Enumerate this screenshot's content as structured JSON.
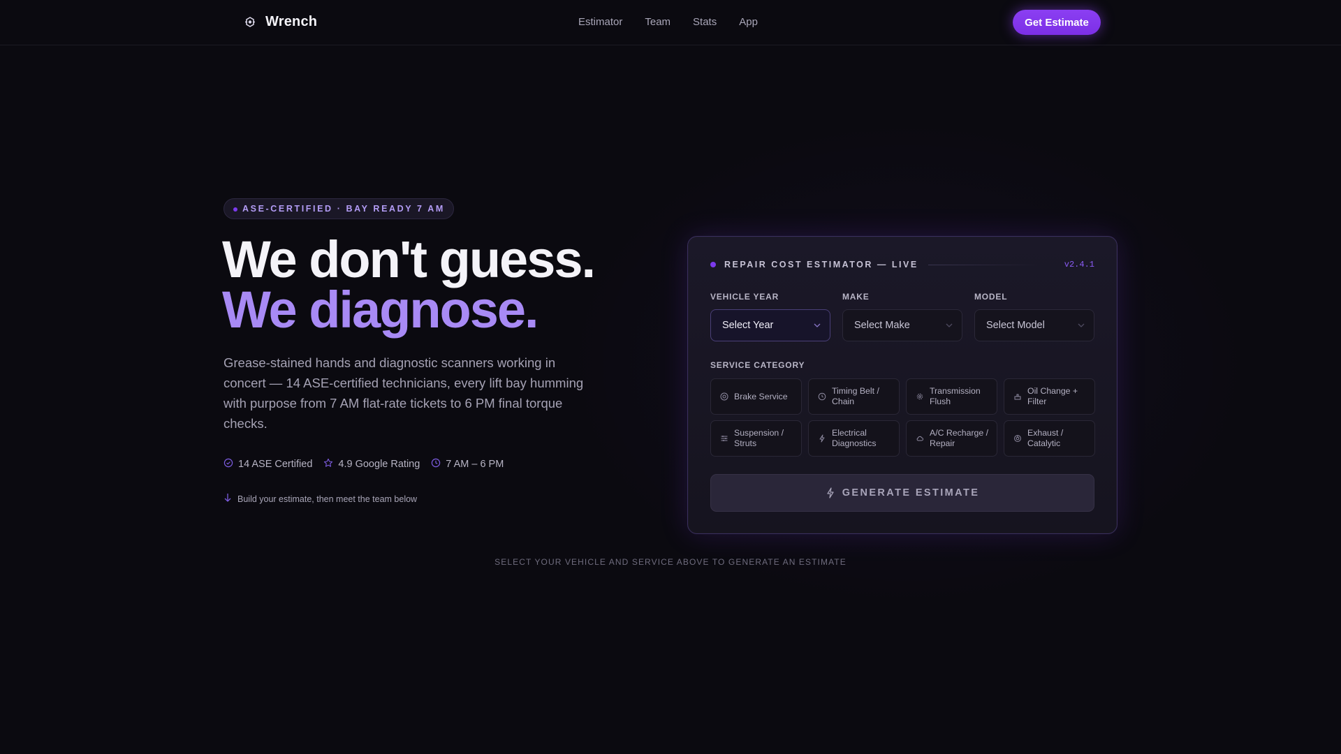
{
  "nav": {
    "brand": "Wrench",
    "links": [
      "Estimator",
      "Team",
      "Stats",
      "App"
    ],
    "cta": "Get Estimate"
  },
  "hero": {
    "badge": "ASE-CERTIFIED · BAY READY 7 AM",
    "headline_1": "We don't guess.",
    "headline_2": "We diagnose.",
    "lead": "Grease-stained hands and diagnostic scanners working in concert — 14 ASE-certified technicians, every lift bay humming with purpose from 7 AM flat-rate tickets to 6 PM final torque checks.",
    "stats": [
      {
        "icon": "check-circle-icon",
        "label": "14 ASE Certified"
      },
      {
        "icon": "star-icon",
        "label": "4.9 Google Rating"
      },
      {
        "icon": "clock-icon",
        "label": "7 AM – 6 PM"
      }
    ],
    "hint": "Build your estimate, then meet the team below"
  },
  "estimator": {
    "title": "REPAIR COST ESTIMATOR — LIVE",
    "version": "v2.4.1",
    "fields": {
      "year": {
        "label": "VEHICLE YEAR",
        "value": "Select Year"
      },
      "make": {
        "label": "MAKE",
        "value": "Select Make"
      },
      "model": {
        "label": "MODEL",
        "value": "Select Model"
      }
    },
    "service_label": "SERVICE CATEGORY",
    "services": [
      {
        "icon": "target-icon",
        "label": "Brake Service"
      },
      {
        "icon": "clock-icon",
        "label": "Timing Belt / Chain"
      },
      {
        "icon": "gear-icon",
        "label": "Transmission Flush"
      },
      {
        "icon": "oil-can-icon",
        "label": "Oil Change + Filter"
      },
      {
        "icon": "sliders-icon",
        "label": "Suspension / Struts"
      },
      {
        "icon": "bolt-icon",
        "label": "Electrical Diagnostics"
      },
      {
        "icon": "cloud-icon",
        "label": "A/C Recharge / Repair"
      },
      {
        "icon": "exhaust-icon",
        "label": "Exhaust / Catalytic"
      }
    ],
    "generate": "GENERATE ESTIMATE"
  },
  "footnote": "SELECT YOUR VEHICLE AND SERVICE ABOVE TO GENERATE AN ESTIMATE",
  "colors": {
    "accent": "#7c3aed",
    "accent_light": "#a88af5",
    "background": "#0b0a10"
  }
}
